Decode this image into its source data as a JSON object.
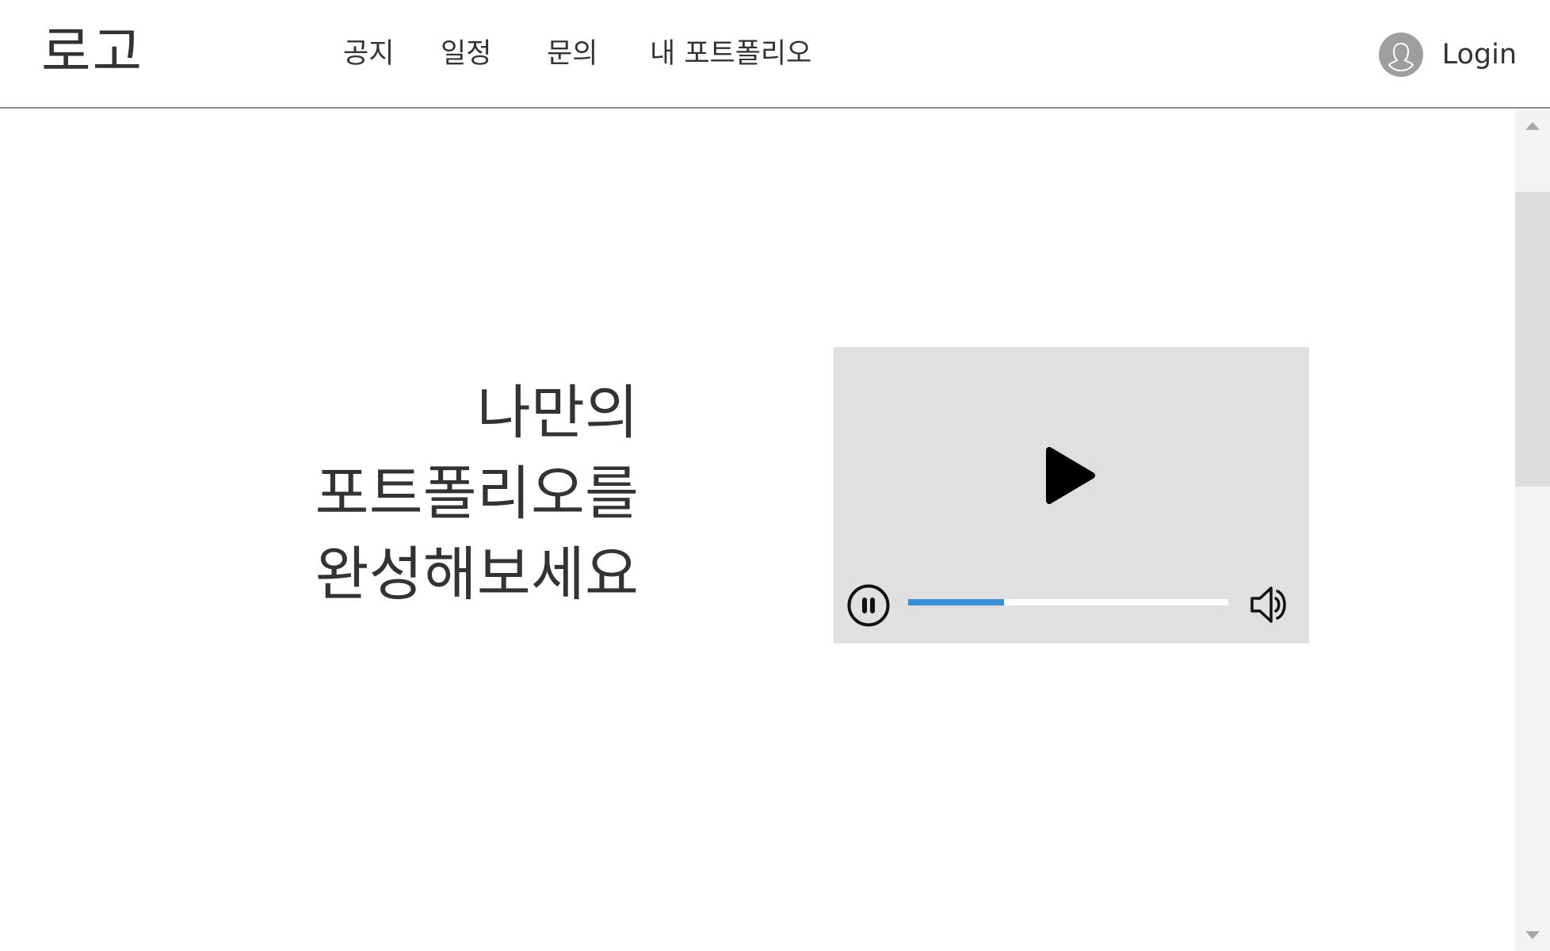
{
  "header": {
    "logo": "로고",
    "nav": [
      {
        "label": "공지"
      },
      {
        "label": "일정"
      },
      {
        "label": "문의"
      },
      {
        "label": "내 포트폴리오"
      }
    ],
    "login_label": "Login",
    "avatar_icon": "user-avatar-icon"
  },
  "hero": {
    "lines": [
      "나만의",
      "포트폴리오를",
      "완성해보세요"
    ]
  },
  "video": {
    "play_icon": "play-icon",
    "pause_icon": "pause-icon",
    "volume_icon": "volume-icon",
    "progress_fraction": 0.3,
    "progress_color": "#3a8fd6",
    "background_color": "#e0e0e0"
  },
  "scrollbar": {
    "up_icon": "scroll-up-arrow-icon",
    "down_icon": "scroll-down-arrow-icon"
  }
}
